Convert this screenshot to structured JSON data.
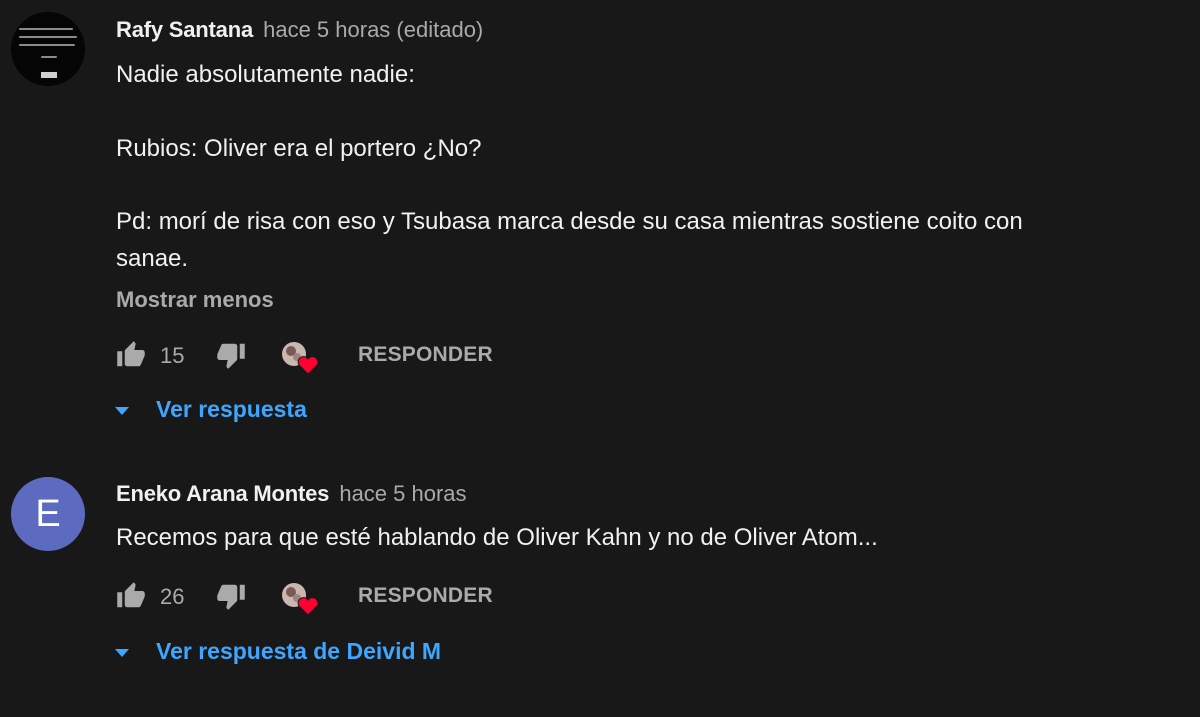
{
  "colors": {
    "background": "#181818",
    "link_blue": "#3ea6ff",
    "secondary_text": "#aaaaaa",
    "heart_red": "#ff0033"
  },
  "comments": [
    {
      "author": "Rafy Santana",
      "time": "hace 5 horas (editado)",
      "avatar_type": "image",
      "text_lines": [
        "Nadie absolutamente nadie:",
        "Rubios: Oliver era el portero ¿No?",
        "Pd: morí de risa con eso y Tsubasa marca desde su casa mientras sostiene coito con",
        "sanae."
      ],
      "show_less_label": "Mostrar menos",
      "like_count": "15",
      "reply_label": "RESPONDER",
      "view_replies_label": "Ver respuesta",
      "icons": [
        "thumb-up-icon",
        "thumb-down-icon",
        "creator-heart-icon",
        "caret-down-icon"
      ]
    },
    {
      "author": "Eneko Arana Montes",
      "time": "hace 5 horas",
      "avatar_type": "letter",
      "avatar_letter": "E",
      "text_lines": [
        "Recemos para que esté hablando de Oliver Kahn y no de Oliver Atom..."
      ],
      "like_count": "26",
      "reply_label": "RESPONDER",
      "view_replies_label": "Ver respuesta de Deivid M",
      "icons": [
        "thumb-up-icon",
        "thumb-down-icon",
        "creator-heart-icon",
        "caret-down-icon"
      ]
    }
  ]
}
